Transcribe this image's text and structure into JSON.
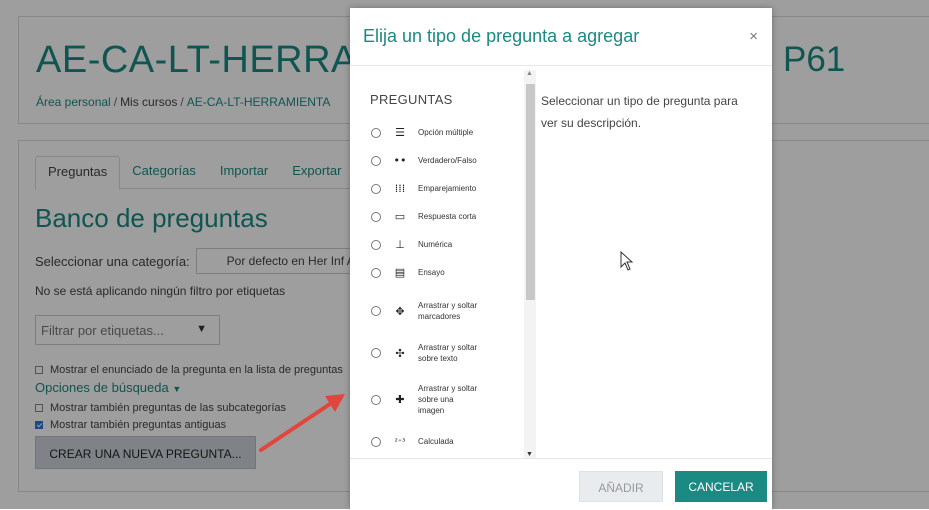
{
  "course": {
    "title_left": "AE-CA-LT-HERRAMI",
    "title_right": "P61",
    "breadcrumb": [
      "Área personal",
      "Mis cursos",
      "AE-CA-LT-HERRAMIENTA"
    ]
  },
  "tabs": [
    "Preguntas",
    "Categorías",
    "Importar",
    "Exportar"
  ],
  "bank": {
    "title": "Banco de preguntas",
    "category_label": "Seleccionar una categoría:",
    "category_value": "Por defecto en Her Inf A",
    "no_filter_text": "No se está aplicando ningún filtro por etiquetas",
    "tag_filter_placeholder": "Filtrar por etiquetas...",
    "show_text_label": "Mostrar el enunciado de la pregunta en la lista de preguntas",
    "search_options": "Opciones de búsqueda",
    "show_subcats_label": "Mostrar también preguntas de las subcategorías",
    "show_old_label": "Mostrar también preguntas antiguas",
    "create_button": "CREAR UNA NUEVA PREGUNTA..."
  },
  "modal": {
    "title": "Elija un tipo de pregunta a agregar",
    "close": "×",
    "list_heading": "PREGUNTAS",
    "items": [
      {
        "label": "Opción múltiple",
        "icon": "list-icon"
      },
      {
        "label": "Verdadero/Falso",
        "icon": "dots-icon"
      },
      {
        "label": "Emparejamiento",
        "icon": "matching-icon"
      },
      {
        "label": "Respuesta corta",
        "icon": "short-answer-icon"
      },
      {
        "label": "Numérica",
        "icon": "numerical-icon"
      },
      {
        "label": "Ensayo",
        "icon": "essay-icon"
      },
      {
        "label": "Arrastrar y soltar marcadores",
        "icon": "move-icon"
      },
      {
        "label": "Arrastrar y soltar sobre texto",
        "icon": "drag-text-icon"
      },
      {
        "label": "Arrastrar y soltar sobre una imagen",
        "icon": "drag-image-icon"
      },
      {
        "label": "Calculada",
        "icon": "calculated-icon"
      }
    ],
    "description": "Seleccionar un tipo de pregunta para ver su descripción.",
    "add_button": "AÑADIR",
    "cancel_button": "CANCELAR"
  },
  "colors": {
    "accent": "#1a8a83",
    "arrow": "#e0463c"
  }
}
